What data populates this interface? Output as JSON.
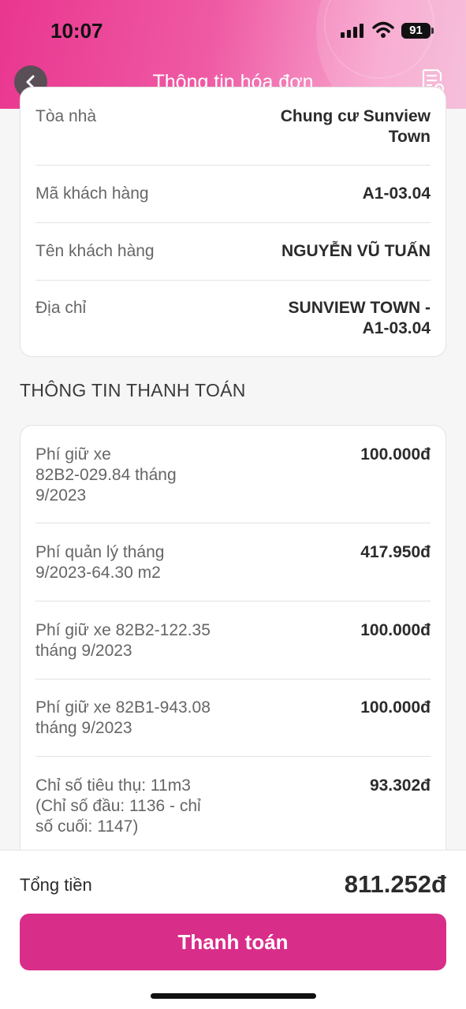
{
  "status_bar": {
    "time": "10:07",
    "battery": "91"
  },
  "header": {
    "title": "Thông tin hóa đơn"
  },
  "customer_info": [
    {
      "label": "Tòa nhà",
      "value_lines": [
        "Chung cư Sunview",
        "Town"
      ]
    },
    {
      "label": "Mã khách hàng",
      "value_lines": [
        "A1-03.04"
      ]
    },
    {
      "label": "Tên khách hàng",
      "value_lines": [
        "NGUYỄN VŨ TUẤN"
      ]
    },
    {
      "label": "Địa chỉ",
      "value_lines": [
        "SUNVIEW TOWN -",
        "A1-03.04"
      ]
    }
  ],
  "payment_section": {
    "title": "THÔNG TIN THANH TOÁN"
  },
  "payment_items": [
    {
      "label_lines": [
        "Phí giữ xe",
        "82B2-029.84 tháng",
        "9/2023"
      ],
      "amount": "100.000đ"
    },
    {
      "label_lines": [
        "Phí quản lý tháng",
        "9/2023-64.30 m2"
      ],
      "amount": "417.950đ"
    },
    {
      "label_lines": [
        "Phí giữ xe 82B2-122.35",
        "tháng 9/2023"
      ],
      "amount": "100.000đ"
    },
    {
      "label_lines": [
        "Phí giữ xe 82B1-943.08",
        "tháng 9/2023"
      ],
      "amount": "100.000đ"
    },
    {
      "label_lines": [
        "Chỉ số tiêu thụ: 11m3",
        "(Chỉ số đầu: 1136 - chỉ",
        "số cuối: 1147)"
      ],
      "amount": "93.302đ"
    }
  ],
  "footer": {
    "total_label": "Tổng tiền",
    "total_value": "811.252đ",
    "pay_button": "Thanh toán"
  }
}
